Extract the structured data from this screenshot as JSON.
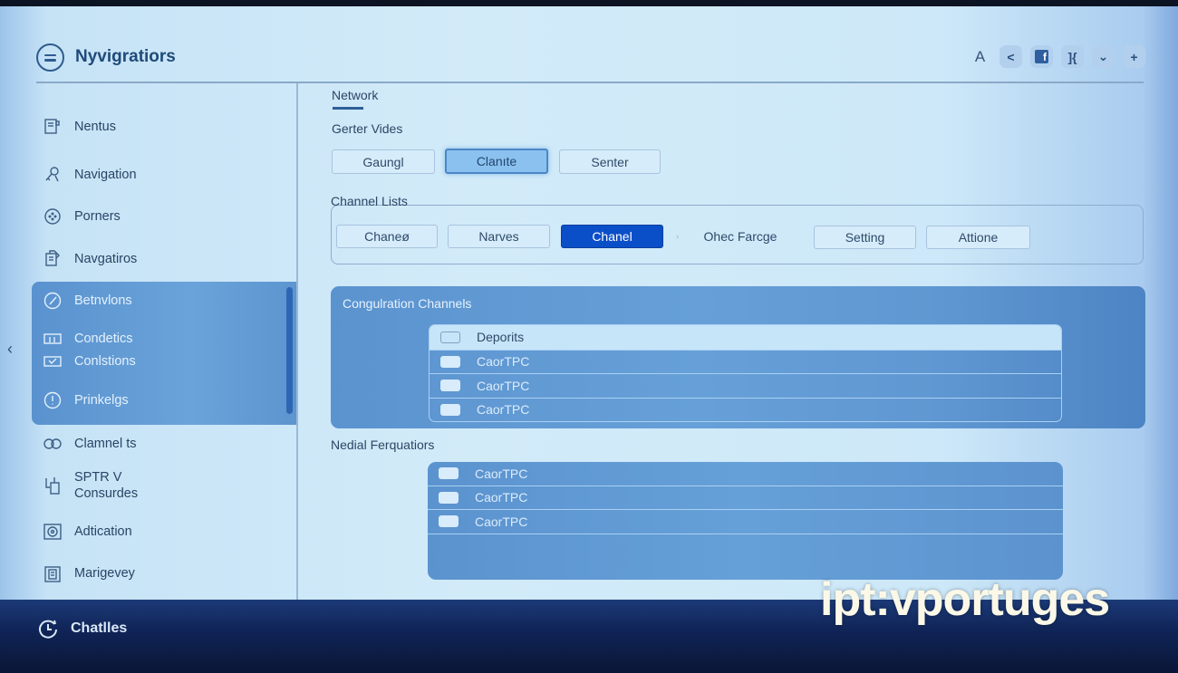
{
  "app": {
    "title": "Nyvigratiors",
    "brand_watermark": "ipt:vportuges"
  },
  "toolbar": {
    "items": [
      {
        "icon": "font-a-icon",
        "glyph": "A"
      },
      {
        "icon": "back-chevron-icon",
        "glyph": "<"
      },
      {
        "icon": "facebook-icon",
        "glyph": "f"
      },
      {
        "icon": "split-view-icon",
        "glyph": "]{"
      },
      {
        "icon": "chevron-down-icon",
        "glyph": "⌄"
      },
      {
        "icon": "plus-icon",
        "glyph": "+"
      }
    ]
  },
  "sidebar": {
    "collapse_glyph": "‹",
    "items": [
      {
        "label": "Nentus",
        "icon": "book-icon"
      },
      {
        "label": "Navigation",
        "icon": "key-person-icon"
      },
      {
        "label": "Porners",
        "icon": "dial-icon"
      },
      {
        "label": "Navgatiros",
        "icon": "document-edit-icon"
      },
      {
        "label": "Betnvlons",
        "icon": "gauge-icon",
        "group": true
      },
      {
        "label": "Condetics",
        "icon": "monitor-icon",
        "group": true
      },
      {
        "label": "Conlstions",
        "icon": "image-check-icon",
        "group": true
      },
      {
        "label": "Prinkelgs",
        "icon": "alert-circle-icon",
        "group": true
      },
      {
        "label": "Clamnel ts",
        "icon": "link-rings-icon"
      },
      {
        "label_line1": "SPTR V",
        "label_line2": "Consurdes",
        "icon": "antenna-device-icon"
      },
      {
        "label": "Adtication",
        "icon": "disc-frame-icon"
      },
      {
        "label": "Marigevey",
        "icon": "clipboard-icon"
      }
    ],
    "footer": {
      "label": "Chatlles",
      "icon": "clock-refresh-icon"
    }
  },
  "main": {
    "tab": "Network",
    "center_videos": {
      "label": "Gerter Vides",
      "buttons": [
        {
          "label": "Gaungl",
          "state": "default"
        },
        {
          "label": "Clanıte",
          "state": "selected"
        },
        {
          "label": "Senter",
          "state": "default"
        }
      ]
    },
    "channel_lists": {
      "legend": "Channel Lists",
      "buttons": [
        {
          "label": "Chaneø",
          "state": "default"
        },
        {
          "label": "Narves",
          "state": "default"
        },
        {
          "label": "Chanel",
          "state": "active"
        },
        {
          "label": "Ohec Farcge",
          "state": "text"
        },
        {
          "label": "Setting",
          "state": "default"
        },
        {
          "label": "Attione",
          "state": "default"
        }
      ]
    },
    "configuration_channels": {
      "title": "Congulration Channels",
      "header_row": "Deporits",
      "rows": [
        "CaorTPC",
        "CaorTPC",
        "CaorTPC"
      ]
    },
    "media_configurations": {
      "title": "Nedial Ferquatiors",
      "rows": [
        "CaorTPC",
        "CaorTPC",
        "CaorTPC"
      ]
    }
  },
  "colors": {
    "accent": "#0b4fc8",
    "panel": "#5f97d2",
    "background": "#d2ebf9",
    "footer": "#0f2355"
  }
}
